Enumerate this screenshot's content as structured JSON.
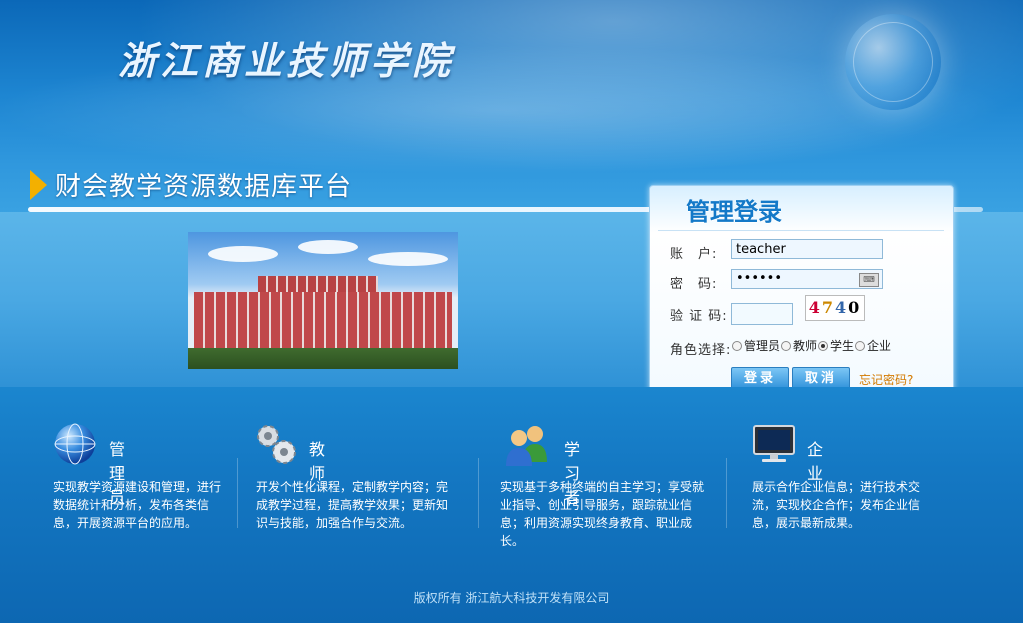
{
  "header": {
    "school_name": "浙江商业技师学院",
    "platform_title": "财会教学资源数据库平台"
  },
  "login": {
    "title": "管理登录",
    "account_label": "账　户:",
    "account_value": "teacher",
    "password_label": "密　码:",
    "password_value": "••••••",
    "captcha_label": "验 证 码:",
    "captcha_value": "",
    "captcha_chars": [
      "4",
      "7",
      "4",
      "0"
    ],
    "role_label": "角色选择:",
    "roles": [
      {
        "label": "管理员",
        "selected": false
      },
      {
        "label": "教师",
        "selected": false
      },
      {
        "label": "学生",
        "selected": true
      },
      {
        "label": "企业",
        "selected": false
      }
    ],
    "login_button": "登录",
    "cancel_button": "取消",
    "forgot_link": "忘记密码?"
  },
  "features": [
    {
      "icon": "globe-network-icon",
      "title": "管理员",
      "desc": "实现教学资源建设和管理，进行数据统计和分析，发布各类信息，开展资源平台的应用。"
    },
    {
      "icon": "gears-icon",
      "title": "教师",
      "desc": "开发个性化课程，定制教学内容；完成教学过程，提高教学效果；更新知识与技能，加强合作与交流。"
    },
    {
      "icon": "users-icon",
      "title": "学习者",
      "desc": "实现基于多种终端的自主学习；享受就业指导、创业引导服务，跟踪就业信息；利用资源实现终身教育、职业成长。"
    },
    {
      "icon": "monitor-icon",
      "title": "企业",
      "desc": "展示合作企业信息；进行技术交流，实现校企合作；发布企业信息，展示最新成果。"
    }
  ],
  "footer": {
    "copyright": "版权所有 浙江航大科技开发有限公司"
  },
  "colors": {
    "accent": "#f3b000",
    "login_title": "#1479c8",
    "forgot": "#d37a00"
  }
}
